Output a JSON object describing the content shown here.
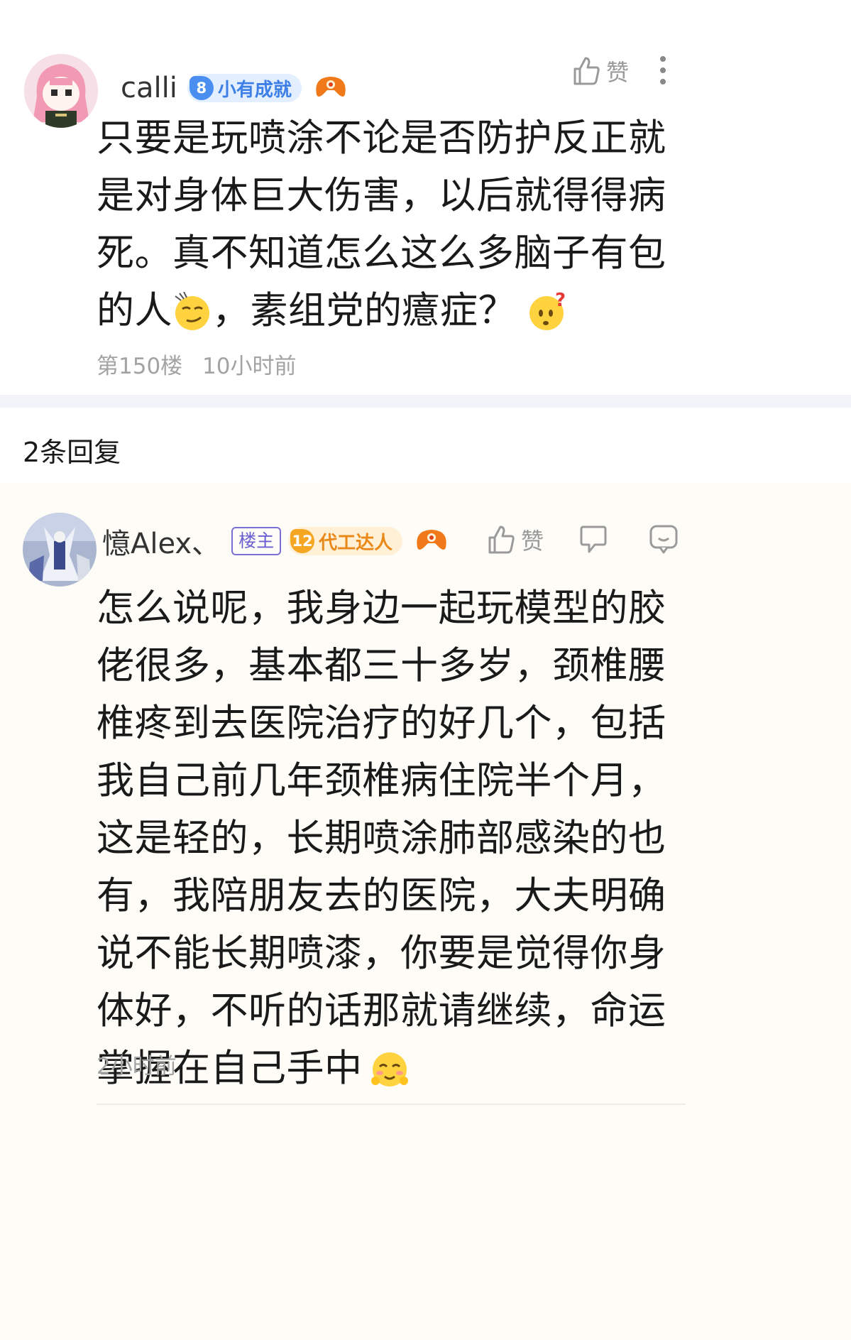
{
  "post": {
    "user": {
      "name": "calli",
      "level": "8",
      "level_title": "小有成就"
    },
    "like_label": "赞",
    "content_parts": [
      "只要是玩喷涂不论是否防护反正就是对身体巨大伤害，以后就得得病死。真不知道怎么这么多脑子有包的人",
      "，素组党的癔症？ "
    ],
    "content_emoji": [
      "smirk-emoji",
      "question-emoji"
    ],
    "floor": "第150楼",
    "time": "10小时前"
  },
  "replies_header": "2条回复",
  "reply": {
    "user": {
      "name": "憶Alex、",
      "author_tag": "楼主",
      "level": "12",
      "level_title": "代工达人"
    },
    "like_label": "赞",
    "content": "怎么说呢，我身边一起玩模型的胶佬很多，基本都三十多岁，颈椎腰椎疼到去医院治疗的好几个，包括我自己前几年颈椎病住院半个月，这是轻的，长期喷涂肺部感染的也有，我陪朋友去的医院，大夫明确说不能长期喷漆，你要是觉得你身体好，不听的话那就请继续，命运掌握在自己手中",
    "content_emoji": "blush-emoji",
    "time": "2小时前"
  },
  "colors": {
    "level8": "#4a8ff0",
    "level12": "#f5a623",
    "reply_bg": "#fdfcf6",
    "divider": "#f3f4fa"
  }
}
